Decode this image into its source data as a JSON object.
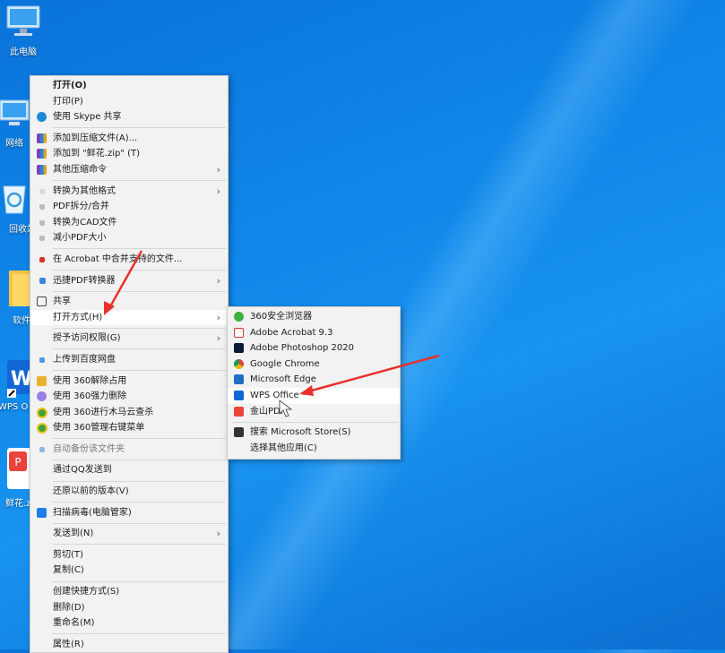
{
  "desktop": {
    "icons": [
      {
        "label": "此电脑"
      },
      {
        "label": "网络"
      },
      {
        "label": "回收站"
      },
      {
        "label": "软件"
      },
      {
        "label": "WPS O"
      },
      {
        "label": "鲜花.z"
      }
    ]
  },
  "context_menu": {
    "items": [
      {
        "label": "打开(O)"
      },
      {
        "label": "打印(P)"
      },
      {
        "label": "使用 Skype 共享"
      },
      {
        "label": "添加到压缩文件(A)..."
      },
      {
        "label": "添加到 \"鲜花.zip\" (T)"
      },
      {
        "label": "其他压缩命令"
      },
      {
        "label": "转换为其他格式"
      },
      {
        "label": "PDF拆分/合并"
      },
      {
        "label": "转换为CAD文件"
      },
      {
        "label": "减小PDF大小"
      },
      {
        "label": "在 Acrobat 中合并支持的文件..."
      },
      {
        "label": "迅捷PDF转换器"
      },
      {
        "label": "共享"
      },
      {
        "label": "打开方式(H)"
      },
      {
        "label": "授予访问权限(G)"
      },
      {
        "label": "上传到百度网盘"
      },
      {
        "label": "使用 360解除占用"
      },
      {
        "label": "使用 360强力删除"
      },
      {
        "label": "使用 360进行木马云查杀"
      },
      {
        "label": "使用 360管理右键菜单"
      },
      {
        "label": "自动备份该文件夹"
      },
      {
        "label": "通过QQ发送到"
      },
      {
        "label": "还原以前的版本(V)"
      },
      {
        "label": "扫描病毒(电脑管家)"
      },
      {
        "label": "发送到(N)"
      },
      {
        "label": "剪切(T)"
      },
      {
        "label": "复制(C)"
      },
      {
        "label": "创建快捷方式(S)"
      },
      {
        "label": "删除(D)"
      },
      {
        "label": "重命名(M)"
      },
      {
        "label": "属性(R)"
      }
    ]
  },
  "open_with_menu": {
    "items": [
      {
        "label": "360安全浏览器"
      },
      {
        "label": "Adobe Acrobat 9.3"
      },
      {
        "label": "Adobe Photoshop 2020"
      },
      {
        "label": "Google Chrome"
      },
      {
        "label": "Microsoft Edge"
      },
      {
        "label": "WPS Office"
      },
      {
        "label": "金山PDF"
      },
      {
        "label": "搜索 Microsoft Store(S)"
      },
      {
        "label": "选择其他应用(C)"
      }
    ]
  },
  "colors": {
    "annotation_arrow": "#e8312c",
    "desktop_blue": "#0f86e8"
  }
}
